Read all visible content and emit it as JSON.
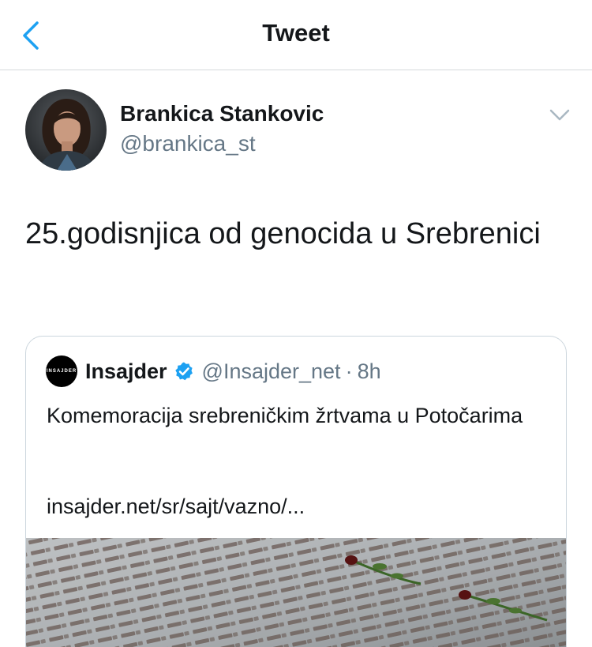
{
  "header": {
    "title": "Tweet",
    "back_icon": "chevron-left-icon"
  },
  "tweet": {
    "author_name": "Brankica Stankovic",
    "author_handle": "@brankica_st",
    "text": "25.godisnjica od genocida u Srebrenici",
    "menu_icon": "chevron-down-icon"
  },
  "quoted_tweet": {
    "avatar_text": "INSAJDER",
    "author_name": "Insajder",
    "verified": true,
    "author_handle": "@Insajder_net",
    "separator": "·",
    "time": "8h",
    "text": "Komemoracija srebreničkim žrtvama u Potočarima",
    "link": "insajder.net/sr/sajt/vazno/...",
    "image_description_icon": "memorial-photo"
  },
  "colors": {
    "accent": "#1da1f2",
    "text": "#14171a",
    "secondary": "#657786",
    "border": "#ccd6dd"
  }
}
